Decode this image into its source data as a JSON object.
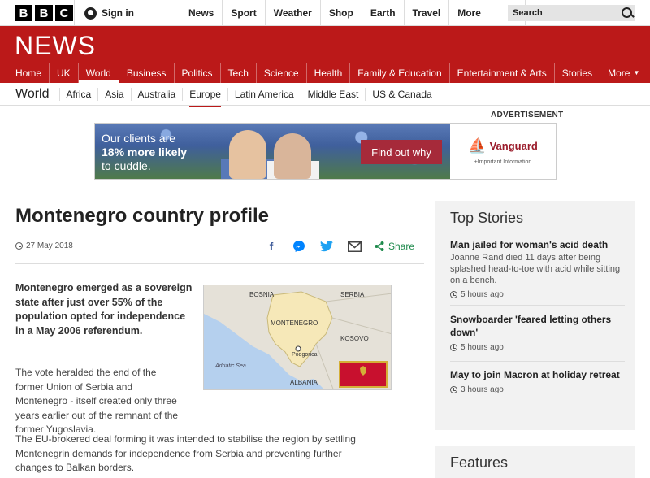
{
  "header": {
    "logo_letters": [
      "B",
      "B",
      "C"
    ],
    "sign_in": "Sign in",
    "nav": [
      "News",
      "Sport",
      "Weather",
      "Shop",
      "Earth",
      "Travel"
    ],
    "more": "More",
    "search_placeholder": "Search"
  },
  "news_logo": "NEWS",
  "main_nav": [
    "Home",
    "UK",
    "World",
    "Business",
    "Politics",
    "Tech",
    "Science",
    "Health",
    "Family & Education",
    "Entertainment & Arts",
    "Stories",
    "More"
  ],
  "main_nav_active": "World",
  "world_nav": {
    "title": "World",
    "items": [
      "Africa",
      "Asia",
      "Australia",
      "Europe",
      "Latin America",
      "Middle East",
      "US & Canada"
    ],
    "active": "Europe"
  },
  "ad": {
    "label": "ADVERTISEMENT",
    "line1": "Our clients are",
    "line2": "18% more likely",
    "line3": "to cuddle.",
    "cta": "Find out why",
    "brand": "Vanguard",
    "info": "+Important Information"
  },
  "article": {
    "title": "Montenegro country profile",
    "date": "27 May 2018",
    "share": "Share",
    "lead": "Montenegro emerged as a sovereign state after just over 55% of the population opted for independence in a May 2006 referendum.",
    "p1": "The vote heralded the end of the former Union of Serbia and Montenegro - itself created only three years earlier out of the remnant of the former Yugoslavia.",
    "p2": "The EU-brokered deal forming it was intended to stabilise the region by settling Montenegrin demands for independence from Serbia and preventing further changes to Balkan borders."
  },
  "map": {
    "labels": {
      "bosnia": "BOSNIA",
      "serbia": "SERBIA",
      "montenegro": "MONTENEGRO",
      "kosovo": "KOSOVO",
      "podgorica": "Podgorica",
      "adriatic": "Adriatic Sea",
      "albania": "ALBANIA"
    },
    "colors": {
      "sea": "#b5d0ee",
      "land": "#e5e1d8",
      "country": "#f6e8b8",
      "flag": "#c8102e",
      "flag_border": "#d4af37"
    }
  },
  "sidebar": {
    "top_stories_title": "Top Stories",
    "stories": [
      {
        "headline": "Man jailed for woman's acid death",
        "summary": "Joanne Rand died 11 days after being splashed head-to-toe with acid while sitting on a bench.",
        "time": "5 hours ago"
      },
      {
        "headline": "Snowboarder 'feared letting others down'",
        "summary": "",
        "time": "5 hours ago"
      },
      {
        "headline": "May to join Macron at holiday retreat",
        "summary": "",
        "time": "3 hours ago"
      }
    ],
    "features_title": "Features"
  },
  "colors": {
    "brand_red": "#bb1919",
    "share_green": "#1e8a4c"
  }
}
